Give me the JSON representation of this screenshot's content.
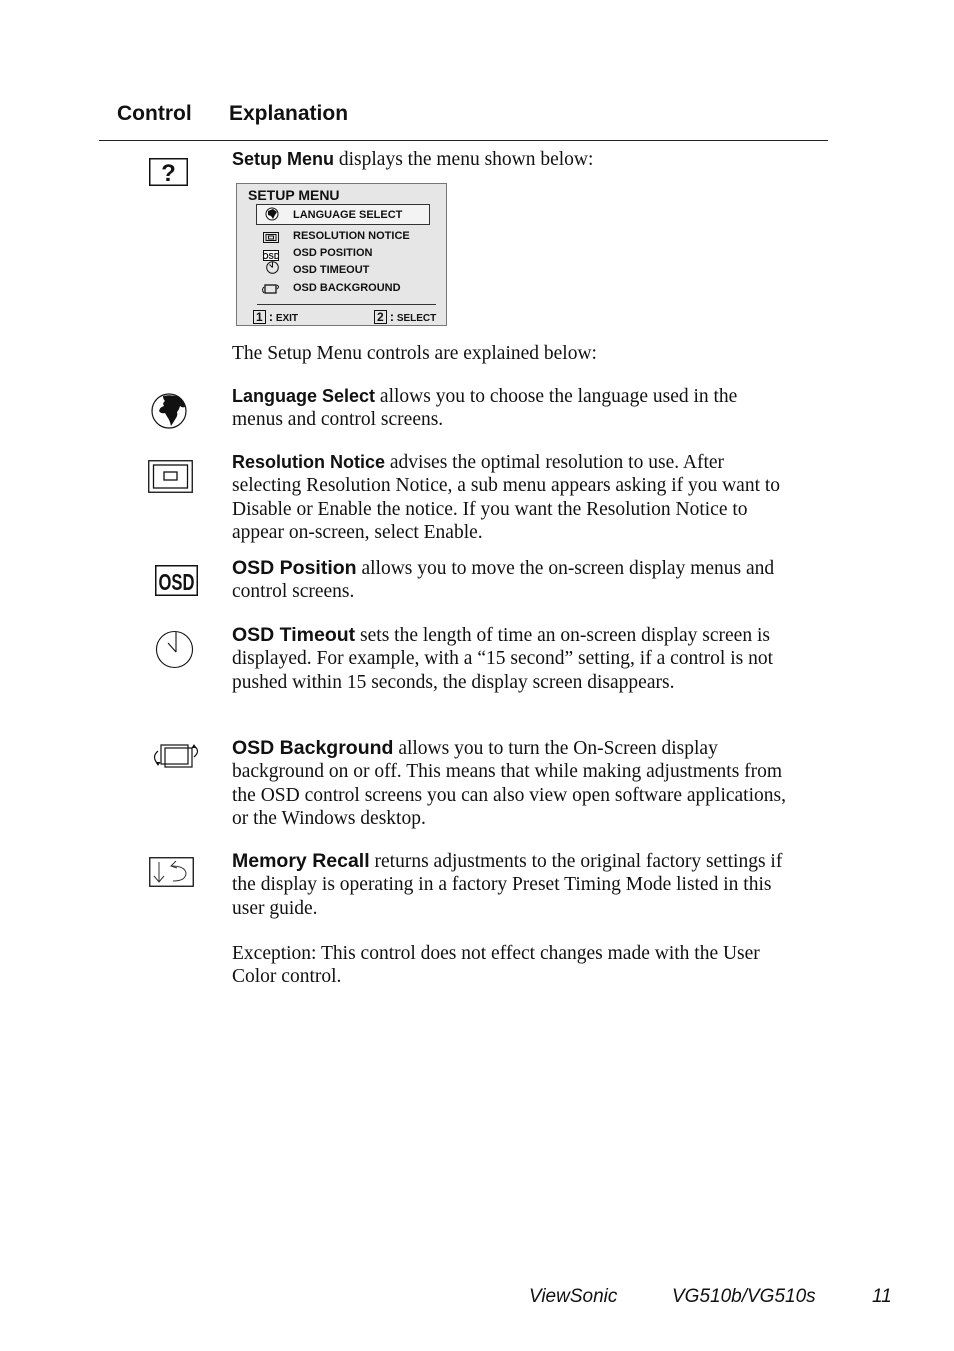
{
  "header": {
    "control_label": "Control",
    "explanation_label": "Explanation"
  },
  "setup_menu": {
    "title": "Setup Menu",
    "text": " displays the menu shown below:",
    "icon": "question-mark-icon",
    "after_text": "The Setup Menu controls are explained below:"
  },
  "osd_menu": {
    "title": "SETUP MENU",
    "items": [
      {
        "label": "LANGUAGE SELECT",
        "icon": "globe-icon",
        "selected": true
      },
      {
        "label": "RESOLUTION NOTICE",
        "icon": "resolution-icon",
        "selected": false
      },
      {
        "label": "OSD POSITION",
        "icon": "osd-icon",
        "selected": false
      },
      {
        "label": "OSD TIMEOUT",
        "icon": "clock-icon",
        "selected": false
      },
      {
        "label": "OSD BACKGROUND",
        "icon": "background-icon",
        "selected": false
      }
    ],
    "key1_num": "1",
    "key1_label": "EXIT",
    "key2_num": "2",
    "key2_label": "SELECT",
    "separator": ":"
  },
  "controls": [
    {
      "name": "Language Select",
      "icon": "globe-icon",
      "text": " allows you to choose the language used in the menus and control screens."
    },
    {
      "name": "Resolution Notice",
      "icon": "resolution-icon",
      "text": " advises the optimal resolution to use. After selecting Resolution Notice, a sub menu appears asking if you want to Disable or Enable the notice. If you want the Resolution Notice to appear on-screen, select Enable."
    },
    {
      "name": "OSD Position",
      "icon": "osd-icon",
      "text": " allows you to move the on-screen display menus and control screens."
    },
    {
      "name": "OSD Timeout",
      "icon": "clock-icon",
      "text": " sets the length of time an on-screen display screen is displayed. For example, with a “15 second” setting, if a control is not pushed within 15 seconds, the display screen disappears."
    },
    {
      "name": "OSD Background",
      "icon": "background-icon",
      "text": " allows you to turn the On-Screen display background on or off. This means that while making adjustments from the OSD control screens you can also view open software applications, or the Windows desktop."
    },
    {
      "name": "Memory Recall",
      "icon": "memory-recall-icon",
      "text": " returns adjustments to the original factory settings if the display is operating in a factory Preset Timing Mode listed in this user guide."
    }
  ],
  "exception_text": "Exception: This control does not effect changes made with the User Color control.",
  "footer": {
    "brand": "ViewSonic",
    "model": "VG510b/VG510s",
    "page_number": "11"
  }
}
